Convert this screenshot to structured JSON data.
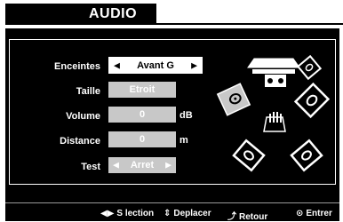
{
  "title": "AUDIO",
  "rows": {
    "speakers": {
      "label": "Enceintes",
      "value": "Avant G"
    },
    "size": {
      "label": "Taille",
      "value": "Etroit"
    },
    "volume": {
      "label": "Volume",
      "value": "0",
      "unit": "dB"
    },
    "distance": {
      "label": "Distance",
      "value": "0",
      "unit": "m"
    },
    "test": {
      "label": "Test",
      "value": "Arret"
    }
  },
  "footer": {
    "select": {
      "icon": "left-right-arrows-icon",
      "label": "S lection"
    },
    "move": {
      "icon": "up-down-arrows-icon",
      "label": "Deplacer"
    },
    "back": {
      "icon": "return-arrow-icon",
      "label": "Retour"
    },
    "enter": {
      "icon": "enter-circle-icon",
      "label": "Entrer"
    }
  },
  "colors": {
    "background": "#000000",
    "field": "#ffffff",
    "field_selected": "#c8c8c8",
    "text": "#ffffff"
  }
}
